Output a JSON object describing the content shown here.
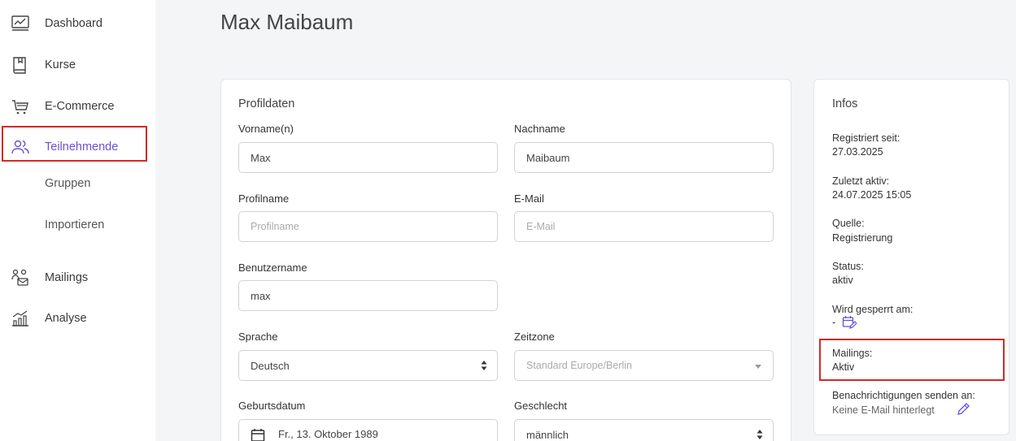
{
  "sidebar": {
    "items": [
      {
        "label": "Dashboard",
        "icon": "dashboard-icon"
      },
      {
        "label": "Kurse",
        "icon": "book-icon"
      },
      {
        "label": "E-Commerce",
        "icon": "cart-icon"
      },
      {
        "label": "Teilnehmende",
        "icon": "users-icon"
      },
      {
        "label": "Gruppen"
      },
      {
        "label": "Importieren"
      },
      {
        "label": "Mailings",
        "icon": "mailings-icon"
      },
      {
        "label": "Analyse",
        "icon": "analytics-icon"
      }
    ],
    "accent": "#6b4fd8"
  },
  "page": {
    "title": "Max Maibaum"
  },
  "profile": {
    "title": "Profildaten",
    "firstname": {
      "label": "Vorname(n)",
      "value": "Max"
    },
    "lastname": {
      "label": "Nachname",
      "value": "Maibaum"
    },
    "profilename": {
      "label": "Profilname",
      "placeholder": "Profilname"
    },
    "email": {
      "label": "E-Mail",
      "placeholder": "E-Mail"
    },
    "username": {
      "label": "Benutzername",
      "value": "max"
    },
    "language": {
      "label": "Sprache",
      "value": "Deutsch"
    },
    "timezone": {
      "label": "Zeitzone",
      "placeholder": "Standard Europe/Berlin"
    },
    "birthdate": {
      "label": "Geburtsdatum",
      "value": "Fr., 13. Oktober 1989"
    },
    "gender": {
      "label": "Geschlecht",
      "value": "männlich"
    }
  },
  "infos": {
    "title": "Infos",
    "registered": {
      "label": "Registriert seit:",
      "value": "27.03.2025"
    },
    "last_active": {
      "label": "Zuletzt aktiv:",
      "value": "24.07.2025 15:05"
    },
    "source": {
      "label": "Quelle:",
      "value": "Registrierung"
    },
    "status": {
      "label": "Status:",
      "value": "aktiv"
    },
    "blocked": {
      "label": "Wird gesperrt am:",
      "value": "-"
    },
    "mailings": {
      "label": "Mailings:",
      "value": "Aktiv"
    },
    "notifications": {
      "label": "Benachrichtigungen senden an:",
      "value": "Keine E-Mail hinterlegt"
    }
  },
  "highlight_color": "#d62828"
}
